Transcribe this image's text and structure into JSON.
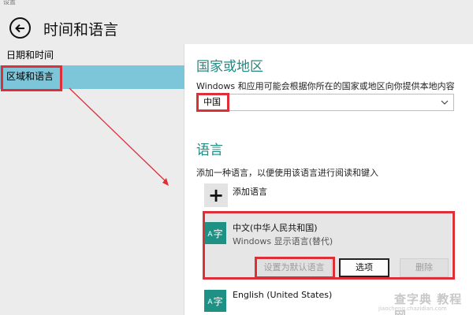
{
  "window": {
    "title": "设置"
  },
  "header": {
    "back_icon": "back-arrow-icon",
    "title": "时间和语言"
  },
  "sidebar": {
    "items": [
      {
        "label": "日期和时间",
        "selected": false
      },
      {
        "label": "区域和语言",
        "selected": true
      }
    ],
    "selected_color": "#7dc5d8"
  },
  "region": {
    "title": "国家或地区",
    "description": "Windows 和应用可能会根据你所在的国家或地区向你提供本地内容",
    "selected_country": "中国"
  },
  "language": {
    "title": "语言",
    "description": "添加一种语言，以便使用该语言进行阅读和键入",
    "add_label": "添加语言",
    "items": [
      {
        "icon_text": "A字",
        "name": "中文(中华人民共和国)",
        "subtitle": "Windows 显示语言(替代)",
        "buttons": {
          "set_default": "设置为默认语言",
          "options": "选项",
          "remove": "删除"
        }
      },
      {
        "icon_text": "A字",
        "name": "English (United States)"
      }
    ]
  },
  "annotation_color": "#dc2f37",
  "accent_color": "#1f8a83",
  "watermark": {
    "text": "查字典 教程网",
    "url": "jiaocheng.chazidian.com"
  }
}
